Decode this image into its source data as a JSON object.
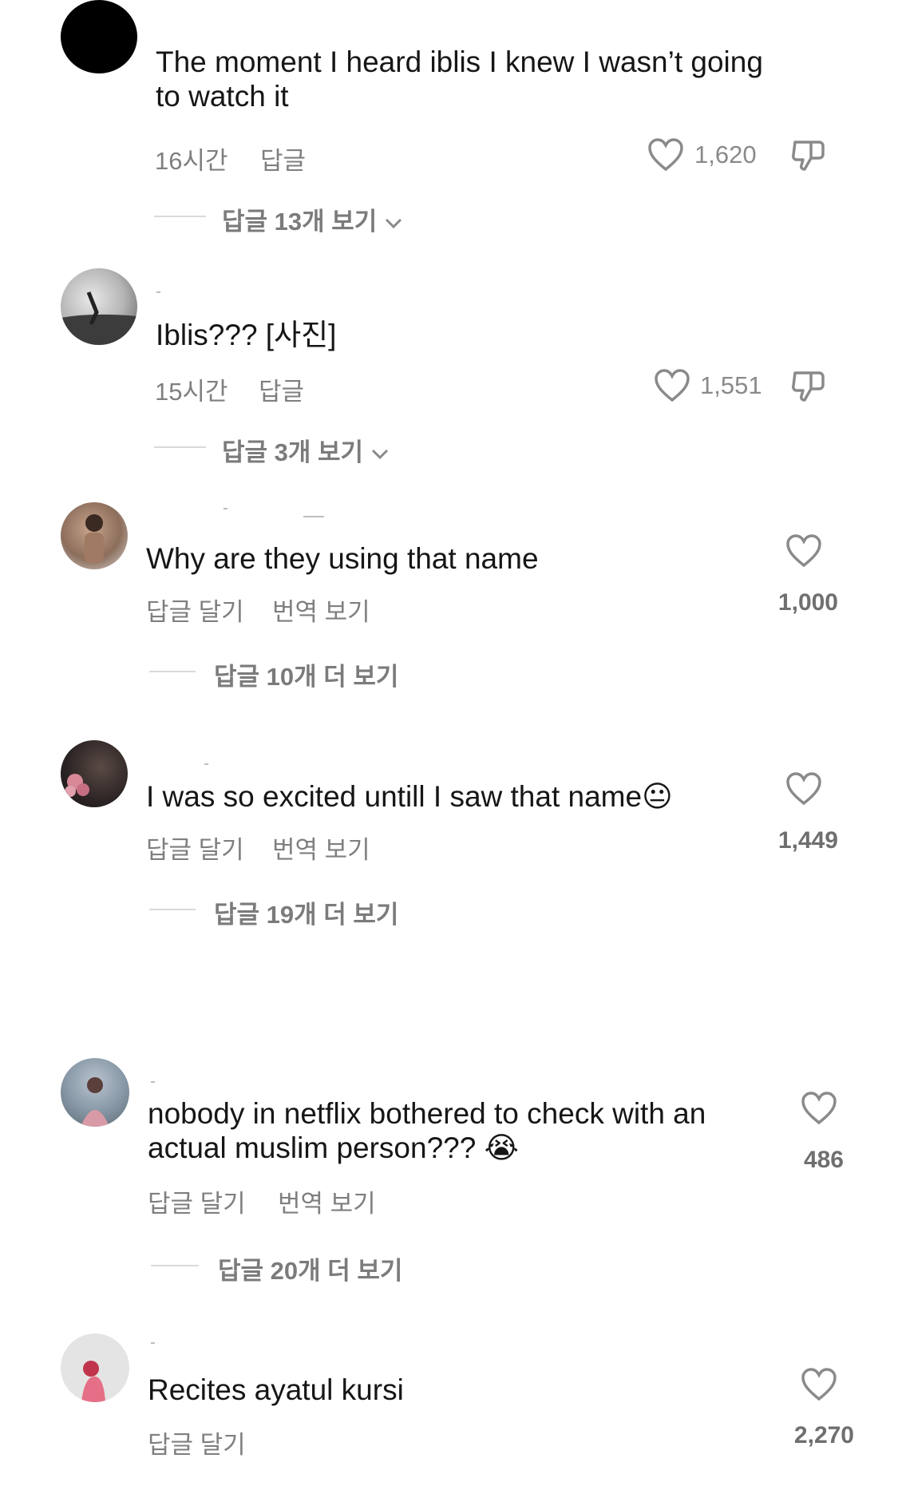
{
  "comments": [
    {
      "text": "The moment I heard iblis I knew I wasn’t going to watch it",
      "time": "16시간",
      "reply": "답글",
      "likes": "1,620",
      "view_replies": "답글 13개 보기",
      "avatar": "black-circle-avatar"
    },
    {
      "text": "Iblis??? [사진]",
      "time": "15시간",
      "reply": "답글",
      "likes": "1,551",
      "view_replies": "답글 3개 보기",
      "avatar": "beach-photo-avatar"
    },
    {
      "text": "Why are they using that name",
      "reply": "답글 달기",
      "translate": "번역 보기",
      "likes": "1,000",
      "view_replies": "답글 10개 더 보기",
      "avatar": "woman-photo-avatar"
    },
    {
      "text": "I was so excited untill I saw that name",
      "emoji": "😐",
      "reply": "답글 달기",
      "translate": "번역 보기",
      "likes": "1,449",
      "view_replies": "답글 19개 더 보기",
      "avatar": "flowers-photo-avatar"
    },
    {
      "text_line1": "nobody in netflix bothered to check with an",
      "text_line2": "actual muslim person??? ",
      "emoji": "😭",
      "reply": "답글 달기",
      "translate": "번역 보기",
      "likes": "486",
      "view_replies": "답글 20개 더 보기",
      "avatar": "girl-photo-avatar"
    },
    {
      "text": "Recites ayatul kursi",
      "reply": "답글 달기",
      "likes": "2,270",
      "avatar": "red-figure-avatar"
    }
  ],
  "colors": {
    "text": "#161616",
    "meta": "#7f7f7f",
    "divider": "#dadada"
  }
}
